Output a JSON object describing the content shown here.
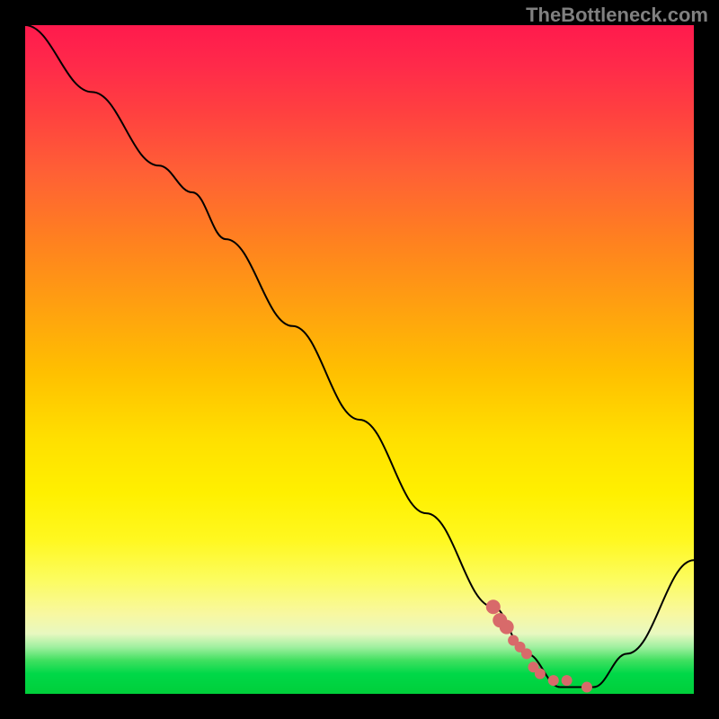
{
  "watermark": "TheBottleneck.com",
  "chart_data": {
    "type": "line",
    "title": "",
    "xlabel": "",
    "ylabel": "",
    "xlim": [
      0,
      100
    ],
    "ylim": [
      0,
      100
    ],
    "series": [
      {
        "name": "bottleneck-curve",
        "color": "#000000",
        "x": [
          0,
          10,
          20,
          25,
          30,
          40,
          50,
          60,
          70,
          75,
          80,
          85,
          90,
          100
        ],
        "y": [
          100,
          90,
          79,
          75,
          68,
          55,
          41,
          27,
          13,
          6,
          1,
          1,
          6,
          20
        ]
      },
      {
        "name": "highlight-dots",
        "color": "#d86a6a",
        "type": "scatter",
        "x": [
          70,
          71,
          72,
          73,
          74,
          75,
          76,
          77,
          79,
          81,
          84
        ],
        "y": [
          13,
          11,
          10,
          8,
          7,
          6,
          4,
          3,
          2,
          2,
          1
        ]
      }
    ],
    "gradient_stops": [
      {
        "pct": 0,
        "color": "#ff1a4d"
      },
      {
        "pct": 50,
        "color": "#ffc000"
      },
      {
        "pct": 75,
        "color": "#fff000"
      },
      {
        "pct": 95,
        "color": "#40e060"
      },
      {
        "pct": 100,
        "color": "#00cf3a"
      }
    ]
  }
}
